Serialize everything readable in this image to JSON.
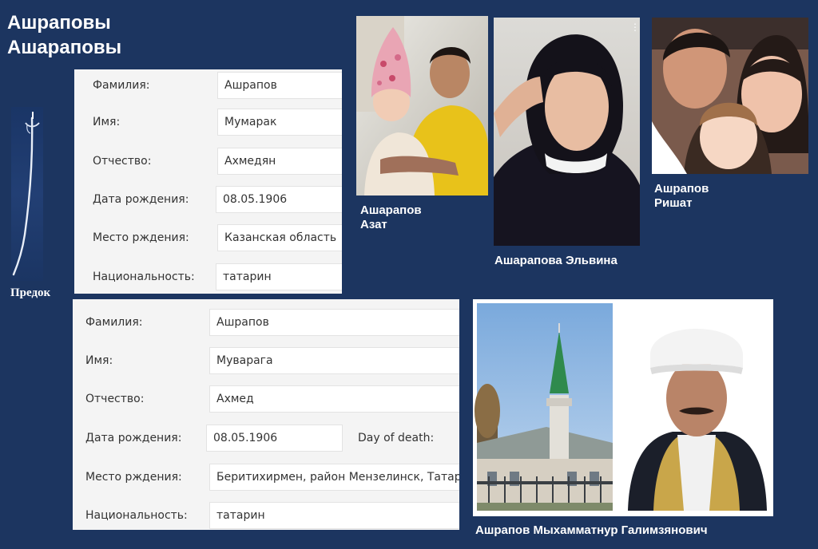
{
  "header": {
    "line1": "Ашраповы",
    "line2": "Ашараповы"
  },
  "ancestor": {
    "label": "Предок",
    "icon": "sword-icon"
  },
  "card1": {
    "rows": [
      {
        "label": "Фамилия:",
        "value": "Ашрапов"
      },
      {
        "label": "Имя:",
        "value": "Мумарак"
      },
      {
        "label": "Отчество:",
        "value": "Ахмедян"
      },
      {
        "label": "Дата рождения:",
        "value": "08.05.1906"
      },
      {
        "label": "Место рждения:",
        "value": "Казанская область"
      },
      {
        "label": "Национальность:",
        "value": "татарин"
      }
    ]
  },
  "card2": {
    "rows": [
      {
        "label": "Фамилия:",
        "value": "Ашрапов"
      },
      {
        "label": "Имя:",
        "value": "Муварага"
      },
      {
        "label": "Отчество:",
        "value": "Ахмед"
      },
      {
        "label": "Дата рождения:",
        "value": "08.05.1906",
        "extra_label": "Day of death:"
      },
      {
        "label": "Место рждения:",
        "value": "Беритихирмен, район Мензелинск, Татария"
      },
      {
        "label": "Национальность:",
        "value": "татарин"
      }
    ]
  },
  "photos": {
    "azat": {
      "caption_line1": "Ашарапов",
      "caption_line2": "Азат"
    },
    "elvina": {
      "caption": "Ашарапова Эльвина"
    },
    "rishat": {
      "caption_line1": "Ашрапов",
      "caption_line2": "Ришат"
    },
    "imam": {
      "caption": "Ашрапов Мыхамматнур Галимзянович"
    }
  },
  "colors": {
    "background": "#1c3560",
    "card": "#f4f4f4",
    "field": "#ffffff",
    "text": "#333333"
  }
}
